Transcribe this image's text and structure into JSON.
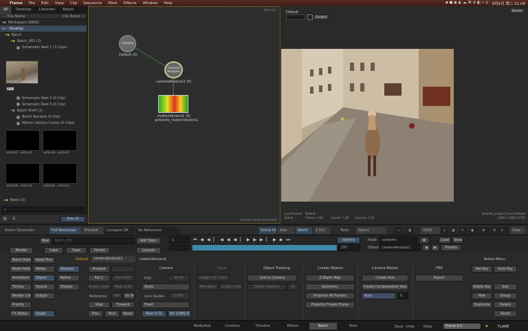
{
  "menubar": {
    "app": "Flame",
    "items": [
      "File",
      "Edit",
      "View",
      "Clip",
      "Sequence",
      "Mark",
      "Effects",
      "Window",
      "Help"
    ],
    "clock": "8月6日 周二 21:08"
  },
  "library": {
    "tabs": [
      "All",
      "Desktop",
      "Libraries",
      "Batch"
    ],
    "col_tree": "— Tree Name",
    "col_clip": "Clip Name —",
    "rows": [
      "Workspace [NEW]",
      "Desktop",
      "Batch",
      "Batch_001 (3)",
      "Schematic Reel 1 (3 Clips)",
      "Schematic Reel 2 (0 Clip)",
      "Schematic Reel 3 (0 Clip)",
      "Batch Shelf (2)",
      "Batch Renders (0 Clip)",
      "Motion Vectors Cache (4 Clips)",
      "Reels (5)"
    ],
    "thumb_main": "222222...ecte-04",
    "thumb_main_badge": "80%",
    "thumbs": [
      "action7...ectors1",
      "action8...ectors1",
      "action6...ectors1",
      "action9...ectors1"
    ],
    "size_label": "Size 22"
  },
  "schematic": {
    "corner": "Batch001",
    "footer": "action4x Action Schematic",
    "nodes": {
      "camera": "Camera",
      "camera_sub": "Default (0)",
      "analysis": "Camera Analysis",
      "analysis_sub": "cameraAnalysis1 (0)",
      "motion": "motionVectors1 (0)",
      "motion_sub": "action4x_motionVectors1"
    }
  },
  "viewer": {
    "title": "Default",
    "output": "Output",
    "monitor": "Monitor",
    "info_left": "Live Preview",
    "info_left2": "Active",
    "info_mid": "Default",
    "info_frame": "Frames: 0.00",
    "info_current": "Current: 1.00",
    "info_gamma": "Gamma: 1.00",
    "info_right": "action4x_output1 [Live] Default",
    "info_res": "1920 x 1080 (1778)"
  },
  "toolbar": {
    "action_schem": "Action Schematic",
    "full_res": "Full Resolution",
    "preview": "Preview",
    "compare": "Compare Off",
    "no_ref": "No Reference",
    "scene": "Scene On",
    "axis": "Axis",
    "world": "World",
    "z_oct": "2 Oct",
    "tools": "Tools",
    "select": "Select",
    "zoom": "100%",
    "view": "View"
  },
  "timeline": {
    "frame": "1",
    "end": "297",
    "options": "Options",
    "node_label": "Node",
    "node_value": "action4x",
    "object_label": "Object",
    "object_value": "cameraAnalysis1",
    "load": "Load",
    "save": "Save",
    "presets": "Presets"
  },
  "params": {
    "new": "New",
    "batch_name": "Batch_001",
    "render": "Render",
    "load": "Load",
    "save": "Save",
    "iterate": "Iterate",
    "add_token": "Add Token",
    "layouts": "Layouts",
    "batch_prefs": "Batch Prefs",
    "node_prefs": "Node Prefs",
    "animation": "Animation",
    "timing": "Timing",
    "render_list": "Render List",
    "priority": "Priority",
    "fx_nodes": "FX Nodes",
    "node_prev": "Node Prev",
    "media": "Media",
    "object": "Object",
    "source": "Source",
    "output": "Output",
    "single": "Single",
    "analyze": "Analyze",
    "refine": "Refine",
    "display": "Display",
    "default_tab": "Default",
    "analysis_tab": "cameraAnalysis1",
    "mv_tab": "motionVectors1",
    "analyse": "Analyse",
    "pos_a": "Pos 1",
    "pos_b": "Pos 1920",
    "fwd": "Fwd",
    "res_a": "Brush...ment",
    "res_b": "Mesh 0.50",
    "reference": "Reference",
    "ref_val": "Iter",
    "goto": "Go To",
    "step": "Step",
    "forward": "Forward",
    "prev": "Prev",
    "next": "Next",
    "reset": "Reset",
    "camera": "Camera",
    "fov": "FOV",
    "fov_val": "44.43",
    "static": "Static",
    "lens_radial": "Lens Radial",
    "lens_val": "0.000",
    "fixed": "Fixed",
    "near": "Near 0.01",
    "far": "Far 11862.6",
    "focal": "Focal",
    "focal_a": "Length 35.0 mm",
    "focal_b": "Film Back",
    "focal_c": "23.40 x 0.00",
    "obj_tracking": "Object Tracking",
    "link_camera": "Link to Camera",
    "create_trackers": "Create Trackers",
    "tracker_val": "40",
    "create_objects": "Create Objects",
    "z_depth": "Z-Depth Map",
    "geometry": "Geometry",
    "projector_all": "Projector All Frames",
    "projector_freeze": "Projector Freeze Frame",
    "camera_motion": "Camera Motion",
    "create_axis": "Create Axis",
    "create_comp": "Create Compensation Axis",
    "auto": "Auto",
    "auto_val": "0",
    "fbx": "FBX",
    "export": "Export",
    "action_menu": "Action Menu",
    "set_key": "Set Key",
    "auto_key": "Auto Key",
    "delete_key": "Delete Key",
    "solo": "Solo",
    "hide": "Hide",
    "group": "Group",
    "duplicate": "Duplicate",
    "delete": "Delete",
    "reset_btn": "Reset"
  },
  "bottombar": {
    "tabs": [
      "MediaHub",
      "Conform",
      "Timeline",
      "Effects",
      "Batch",
      "Tools"
    ],
    "save": "Save",
    "undo": "Undo",
    "redo": "Redo",
    "frame_field": "Frame 0.0",
    "brand": "FLAME"
  }
}
